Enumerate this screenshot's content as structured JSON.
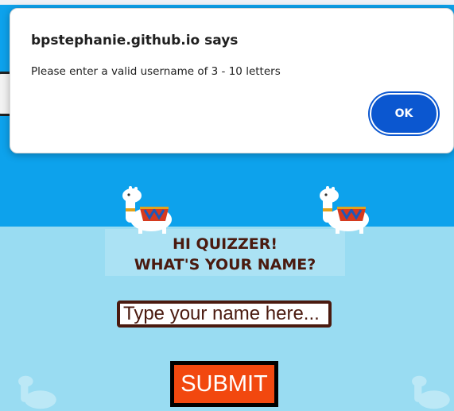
{
  "alert": {
    "title": "bpstephanie.github.io says",
    "message": "Please enter a valid username of 3 - 10 letters",
    "ok_label": "OK"
  },
  "quiz": {
    "greeting_line1": "HI QUIZZER!",
    "greeting_line2": "WHAT'S YOUR NAME?",
    "name_placeholder": "Type your name here...",
    "name_value": "",
    "submit_label": "SUBMIT"
  },
  "colors": {
    "sky": "#0da2ec",
    "panel": "#99dcf2",
    "text_brown": "#4a1a0f",
    "submit_orange": "#f2480f",
    "ok_blue": "#0b57d0"
  },
  "icons": [
    "llama-icon",
    "back-button"
  ]
}
